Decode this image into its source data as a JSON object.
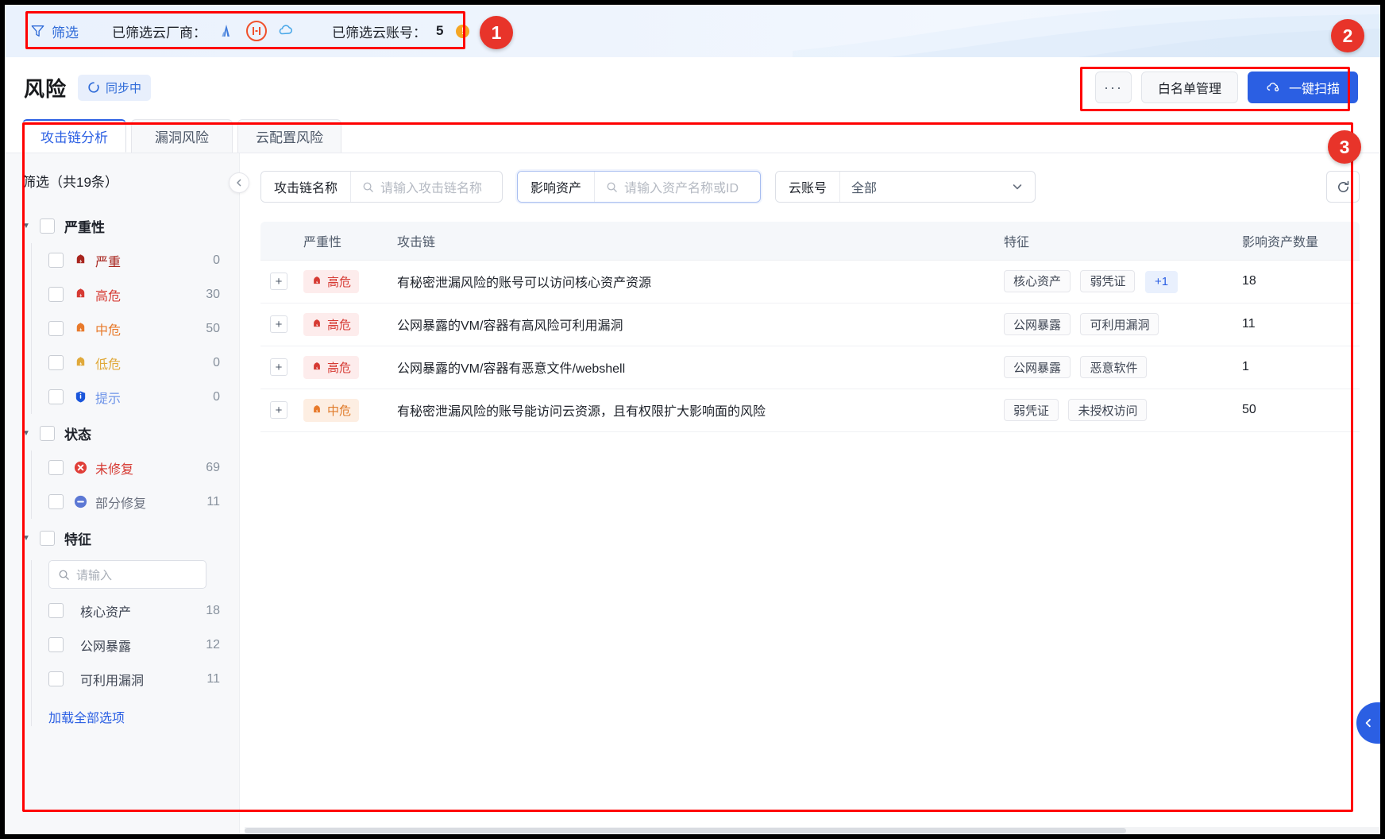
{
  "topbar": {
    "filter_label": "筛选",
    "filter_icon": "filter-icon",
    "vendor_label": "已筛选云厂商：",
    "vendors": [
      {
        "name": "aliyun-icon",
        "color": "#3f7bdb"
      },
      {
        "name": "huawei-cloud-icon",
        "color": "#f0502b"
      },
      {
        "name": "tencent-cloud-icon",
        "color": "#4aa8e8"
      }
    ],
    "account_label": "已筛选云账号：",
    "account_count": "5",
    "account_warn_icon": "warning-icon"
  },
  "header": {
    "title": "风险",
    "sync_badge": "同步中",
    "sync_icon": "sync-spinner-icon",
    "more_button": "···",
    "whitelist_button": "白名单管理",
    "scan_button": "一键扫描",
    "scan_icon": "cloud-scan-icon"
  },
  "tabs": [
    {
      "label": "攻击链分析",
      "active": true
    },
    {
      "label": "漏洞风险",
      "active": false
    },
    {
      "label": "云配置风险",
      "active": false
    }
  ],
  "sidebar": {
    "title": "筛选（共19条）",
    "collapse_icon": "chevron-left-icon",
    "search_placeholder": "请输入",
    "search_icon": "search-icon",
    "load_more": "加载全部选项",
    "groups": [
      {
        "label": "严重性",
        "caret": "▼",
        "options": [
          {
            "label": "严重",
            "count": "0",
            "color": "#a8251e",
            "icon": "severity-critical-icon"
          },
          {
            "label": "高危",
            "count": "30",
            "color": "#d63a33",
            "icon": "severity-high-icon"
          },
          {
            "label": "中危",
            "count": "50",
            "color": "#e87a2b",
            "icon": "severity-medium-icon"
          },
          {
            "label": "低危",
            "count": "0",
            "color": "#e0a93a",
            "icon": "severity-low-icon"
          },
          {
            "label": "提示",
            "count": "0",
            "color": "#6d93e8",
            "icon": "severity-info-icon"
          }
        ]
      },
      {
        "label": "状态",
        "caret": "▼",
        "options": [
          {
            "label": "未修复",
            "count": "69",
            "color": "#d63a33",
            "icon": "status-unfixed-icon"
          },
          {
            "label": "部分修复",
            "count": "11",
            "color": "#6c7280",
            "icon": "status-partial-icon"
          }
        ]
      },
      {
        "label": "特征",
        "caret": "▼",
        "has_search": true,
        "options": [
          {
            "label": "核心资产",
            "count": "18",
            "color": "#3d4452",
            "icon": ""
          },
          {
            "label": "公网暴露",
            "count": "12",
            "color": "#3d4452",
            "icon": ""
          },
          {
            "label": "可利用漏洞",
            "count": "11",
            "color": "#3d4452",
            "icon": ""
          }
        ]
      }
    ]
  },
  "search": {
    "chain_label": "攻击链名称",
    "chain_placeholder": "请输入攻击链名称",
    "asset_label": "影响资产",
    "asset_placeholder": "请输入资产名称或ID",
    "account_label": "云账号",
    "account_value": "全部",
    "refresh_icon": "refresh-icon",
    "search_icon": "search-icon",
    "chevron_icon": "chevron-down-icon"
  },
  "table": {
    "columns": [
      "严重性",
      "攻击链",
      "特征",
      "影响资产数量"
    ],
    "rows": [
      {
        "expand": "+",
        "severity": "高危",
        "severity_level": "high",
        "chain": "有秘密泄漏风险的账号可以访问核心资产资源",
        "tags": [
          "核心资产",
          "弱凭证"
        ],
        "more_tag": "+1",
        "assets": "18"
      },
      {
        "expand": "+",
        "severity": "高危",
        "severity_level": "high",
        "chain": "公网暴露的VM/容器有高风险可利用漏洞",
        "tags": [
          "公网暴露",
          "可利用漏洞"
        ],
        "more_tag": "",
        "assets": "11"
      },
      {
        "expand": "+",
        "severity": "高危",
        "severity_level": "high",
        "chain": "公网暴露的VM/容器有恶意文件/webshell",
        "tags": [
          "公网暴露",
          "恶意软件"
        ],
        "more_tag": "",
        "assets": "1"
      },
      {
        "expand": "+",
        "severity": "中危",
        "severity_level": "mid",
        "chain": "有秘密泄漏风险的账号能访问云资源，且有权限扩大影响面的风险",
        "tags": [
          "弱凭证",
          "未授权访问"
        ],
        "more_tag": "",
        "assets": "50"
      }
    ]
  },
  "annotations": [
    {
      "id": "1"
    },
    {
      "id": "2"
    },
    {
      "id": "3"
    }
  ],
  "right_handle_icon": "chevron-left-icon",
  "colors": {
    "primary": "#2b5fe3",
    "annotation": "#e8342a",
    "high": "#d63a33",
    "mid": "#e87a2b"
  }
}
